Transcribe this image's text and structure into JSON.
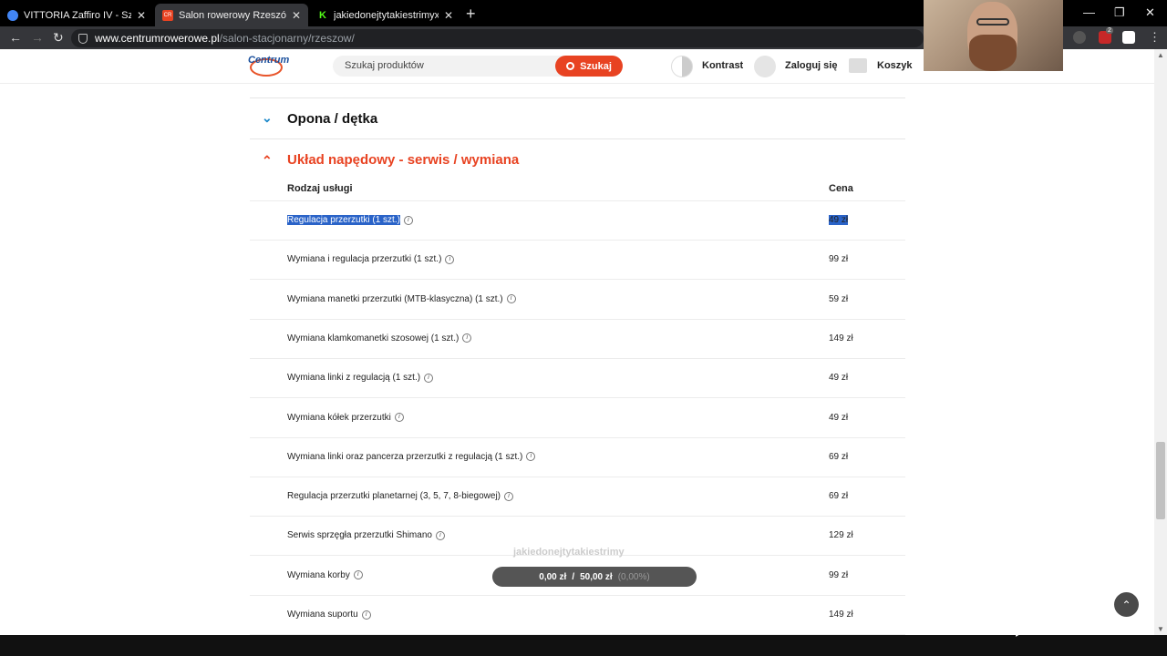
{
  "browser": {
    "tabs": [
      {
        "title": "VITTORIA Zaffiro IV - Szukaj w G",
        "active": false,
        "favicon_color": "#4285f4"
      },
      {
        "title": "Salon rowerowy Rzeszów | Cent",
        "active": true,
        "favicon_color": "#e84322",
        "favicon_text": "CR"
      },
      {
        "title": "jakiedonejtytakiestrimyxD Strea",
        "active": false,
        "favicon_color": "#53fc18",
        "favicon_text": "K"
      }
    ],
    "url_host": "www.centrumrowerowe.pl",
    "url_path": "/salon-stacjonarny/rzeszow/",
    "ext_badge": "2"
  },
  "header": {
    "logo_text": "Centrum",
    "search_placeholder": "Szukaj produktów",
    "search_button": "Szukaj",
    "contrast_label": "Kontrast",
    "login_label": "Zaloguj się",
    "cart_label": "Koszyk"
  },
  "sections": {
    "tire": {
      "title": "Opona / dętka",
      "expanded": false
    },
    "drive": {
      "title": "Układ napędowy - serwis / wymiana",
      "expanded": true
    }
  },
  "table": {
    "col_service": "Rodzaj usługi",
    "col_price": "Cena",
    "info_glyph": "i",
    "rows": [
      {
        "service": "Regulacja przerzutki (1 szt.)",
        "price": "49 zł",
        "selected": true
      },
      {
        "service": "Wymiana i regulacja przerzutki (1 szt.)",
        "price": "99 zł"
      },
      {
        "service": "Wymiana manetki przerzutki (MTB-klasyczna) (1 szt.)",
        "price": "59 zł"
      },
      {
        "service": "Wymiana klamkomanetki szosowej (1 szt.)",
        "price": "149 zł"
      },
      {
        "service": "Wymiana linki z regulacją (1 szt.)",
        "price": "49 zł"
      },
      {
        "service": "Wymiana kółek przerzutki",
        "price": "49 zł"
      },
      {
        "service": "Wymiana linki oraz pancerza przerzutki z regulacją (1 szt.)",
        "price": "69 zł"
      },
      {
        "service": "Regulacja przerzutki planetarnej (3, 5, 7, 8-biegowej)",
        "price": "69 zł"
      },
      {
        "service": "Serwis sprzęgła przerzutki Shimano",
        "price": "129 zł"
      },
      {
        "service": "Wymiana korby",
        "price": "99 zł"
      },
      {
        "service": "Wymiana suportu",
        "price": "149 zł"
      }
    ]
  },
  "overlay": {
    "stream_label": "jakiedonejtytakiestrimy",
    "donate_current": "0,00 zł",
    "donate_separator": "/",
    "donate_goal": "50,00 zł",
    "donate_percent": "(0,00%)",
    "donate_progress": 0
  },
  "colors": {
    "accent": "#e84322",
    "link_blue": "#1a87c9",
    "selection": "#2a63c8"
  }
}
